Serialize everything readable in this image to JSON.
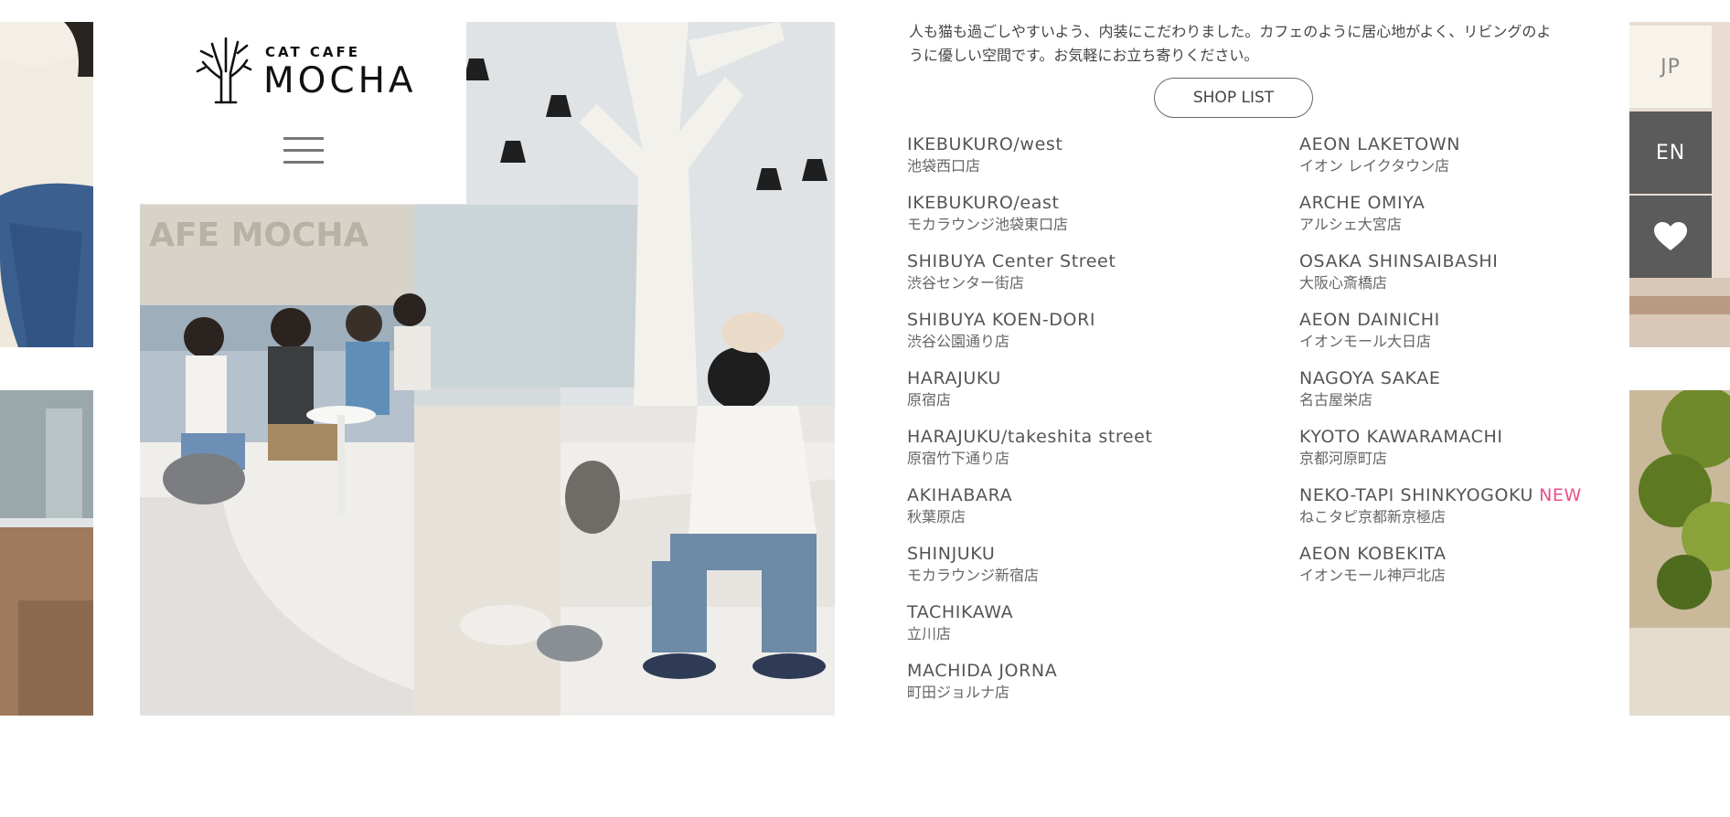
{
  "logo": {
    "subtitle": "CAT CAFE",
    "name": "MOCHA",
    "icon": "tree-logo-icon"
  },
  "menu": {
    "icon": "hamburger-menu-icon"
  },
  "intro_text": "人も猫も過ごしやすいよう、内装にこだわりました。カフェのように居心地がよく、リビングのように優しい空間です。お気軽にお立ち寄りください。",
  "shop_list_label": "SHOP LIST",
  "shops_left": [
    {
      "en": "IKEBUKURO/west",
      "jp": "池袋西口店"
    },
    {
      "en": "IKEBUKURO/east",
      "jp": "モカラウンジ池袋東口店"
    },
    {
      "en": "SHIBUYA Center Street",
      "jp": "渋谷センター街店"
    },
    {
      "en": "SHIBUYA KOEN-DORI",
      "jp": "渋谷公園通り店"
    },
    {
      "en": "HARAJUKU",
      "jp": "原宿店"
    },
    {
      "en": "HARAJUKU/takeshita street",
      "jp": "原宿竹下通り店"
    },
    {
      "en": "AKIHABARA",
      "jp": "秋葉原店"
    },
    {
      "en": "SHINJUKU",
      "jp": "モカラウンジ新宿店"
    },
    {
      "en": "TACHIKAWA",
      "jp": "立川店"
    },
    {
      "en": "MACHIDA JORNA",
      "jp": "町田ジョルナ店"
    }
  ],
  "shops_right": [
    {
      "en": "AEON LAKETOWN",
      "jp": "イオン レイクタウン店"
    },
    {
      "en": "ARCHE OMIYA",
      "jp": "アルシェ大宮店"
    },
    {
      "en": "OSAKA SHINSAIBASHI",
      "jp": "大阪心斎橋店"
    },
    {
      "en": "AEON DAINICHI",
      "jp": "イオンモール大日店"
    },
    {
      "en": "NAGOYA SAKAE",
      "jp": "名古屋栄店"
    },
    {
      "en": "KYOTO KAWARAMACHI",
      "jp": "京都河原町店"
    },
    {
      "en": "NEKO-TAPI SHINKYOGOKU",
      "jp": "ねこタピ京都新京極店",
      "badge": "NEW"
    },
    {
      "en": "AEON KOBEKITA",
      "jp": "イオンモール神戸北店"
    }
  ],
  "language": {
    "jp": "JP",
    "en": "EN",
    "active": "EN"
  },
  "favorite": {
    "icon": "heart-icon"
  },
  "colors": {
    "accent_new": "#e8508a",
    "sidebar_dark": "#5b5b5b",
    "sidebar_light": "#f8f3ea",
    "text": "#444444"
  }
}
